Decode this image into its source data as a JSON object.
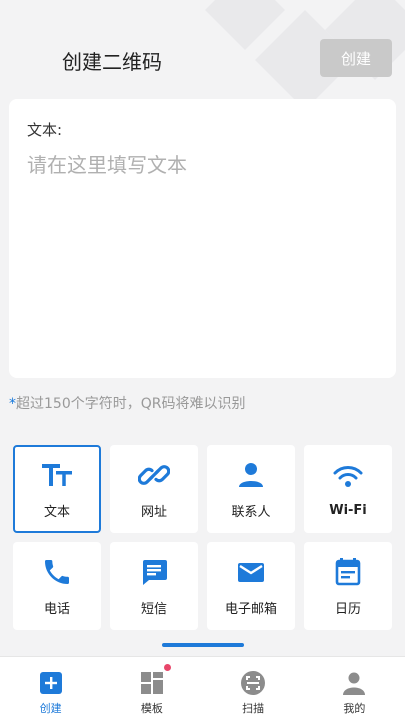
{
  "header": {
    "title": "创建二维码",
    "create_button": "创建"
  },
  "editor": {
    "label": "文本:",
    "placeholder": "请在这里填写文本"
  },
  "hint": {
    "star": "*",
    "text": "超过150个字符时，QR码将难以识别"
  },
  "types": [
    {
      "label": "文本",
      "icon": "text-size-icon",
      "active": true
    },
    {
      "label": "网址",
      "icon": "link-icon"
    },
    {
      "label": "联系人",
      "icon": "person-icon"
    },
    {
      "label": "Wi-Fi",
      "icon": "wifi-icon"
    },
    {
      "label": "电话",
      "icon": "phone-icon"
    },
    {
      "label": "短信",
      "icon": "message-icon"
    },
    {
      "label": "电子邮箱",
      "icon": "mail-icon"
    },
    {
      "label": "日历",
      "icon": "calendar-icon"
    }
  ],
  "nav": [
    {
      "label": "创建",
      "icon": "plus-square-icon",
      "active": true
    },
    {
      "label": "模板",
      "icon": "template-grid-icon",
      "badge": true
    },
    {
      "label": "扫描",
      "icon": "scan-icon"
    },
    {
      "label": "我的",
      "icon": "profile-icon"
    }
  ],
  "colors": {
    "accent": "#1e7ad9",
    "disabled_button": "#c9c9c9",
    "badge": "#e8466a",
    "background": "#f3f3f4"
  }
}
